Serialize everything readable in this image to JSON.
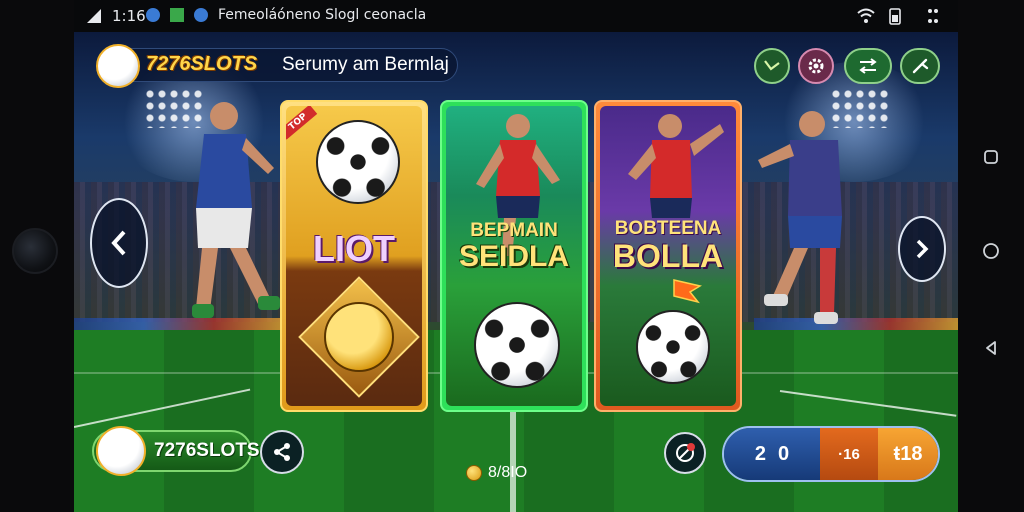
{
  "status_bar": {
    "time": "1:16",
    "notification_text": "Femeoláóneno Slogl ceonacla"
  },
  "header": {
    "brand": "7276SLOTS",
    "subtitle": "Serumy am Bermlaj",
    "buttons": [
      {
        "icon": "graph-icon"
      },
      {
        "icon": "settings-gear-icon"
      },
      {
        "icon": "swap-arrows-icon"
      },
      {
        "icon": "wrench-icon"
      }
    ]
  },
  "cards": [
    {
      "title": "LIOT",
      "corner_tag": "TOP",
      "theme": "gold"
    },
    {
      "title_line1": "BEPMAIN",
      "title_line2": "SEIDLA",
      "theme": "green"
    },
    {
      "title_line1": "BOBTEENA",
      "title_line2": "BOLLA",
      "theme": "purple-orange"
    }
  ],
  "bottom": {
    "brand": "7276SLOTS",
    "coin_label": "8/8IO",
    "bet": {
      "left_value_1": "2",
      "left_value_2": "0",
      "middle_value": "·16",
      "right_value": "ŧ18"
    }
  },
  "colors": {
    "brand_yellow": "#ffd64a",
    "accent_green": "#7ed66f",
    "bet_blue": "#2f5fae",
    "bet_orange": "#f7a533"
  }
}
